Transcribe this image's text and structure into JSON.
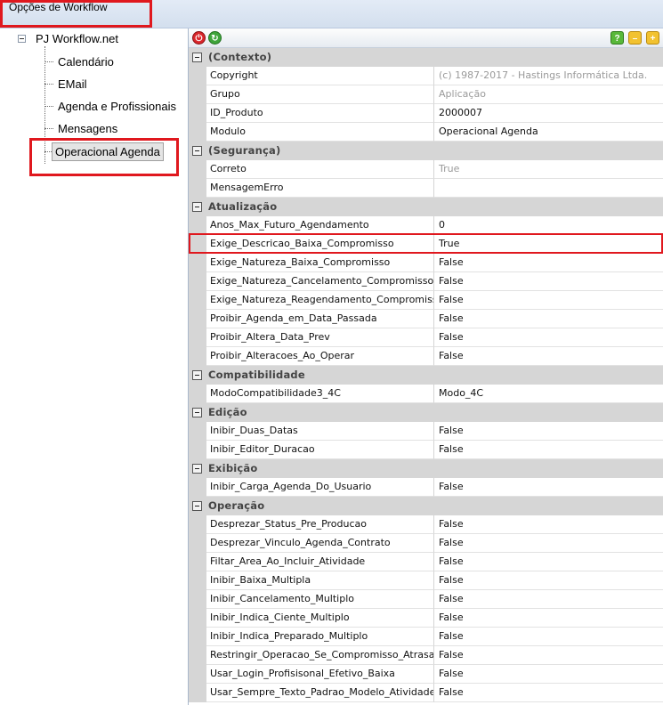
{
  "window": {
    "title": "Opções de Workflow"
  },
  "tree": {
    "root": "PJ Workflow.net",
    "items": [
      "Calendário",
      "EMail",
      "Agenda e Profissionais",
      "Mensagens",
      "Operacional Agenda"
    ]
  },
  "toolbar": {
    "icons": [
      "stop-icon",
      "refresh-icon",
      "help-icon",
      "minimize-icon",
      "add-icon"
    ]
  },
  "grid": {
    "categories": {
      "contexto": "(Contexto)",
      "seguranca": "(Segurança)",
      "atualizacao": "Atualização",
      "compatibilidade": "Compatibilidade",
      "edicao": "Edição",
      "exibicao": "Exibição",
      "operacao": "Operação"
    },
    "rows": {
      "copyright": {
        "name": "Copyright",
        "value": "(c) 1987-2017 - Hastings Informática Ltda."
      },
      "grupo": {
        "name": "Grupo",
        "value": "Aplicação"
      },
      "id_produto": {
        "name": "ID_Produto",
        "value": "2000007"
      },
      "modulo": {
        "name": "Modulo",
        "value": "Operacional Agenda"
      },
      "correto": {
        "name": "Correto",
        "value": "True"
      },
      "mensagem_erro": {
        "name": "MensagemErro",
        "value": ""
      },
      "anos_max": {
        "name": "Anos_Max_Futuro_Agendamento",
        "value": "0"
      },
      "exige_descricao": {
        "name": "Exige_Descricao_Baixa_Compromisso",
        "value": "True"
      },
      "exige_natureza_baixa": {
        "name": "Exige_Natureza_Baixa_Compromisso",
        "value": "False"
      },
      "exige_natureza_cancel": {
        "name": "Exige_Natureza_Cancelamento_Compromisso",
        "value": "False"
      },
      "exige_natureza_reag": {
        "name": "Exige_Natureza_Reagendamento_Compromisso",
        "value": "False"
      },
      "proibir_agenda_passada": {
        "name": "Proibir_Agenda_em_Data_Passada",
        "value": "False"
      },
      "proibir_altera_data": {
        "name": "Proibir_Altera_Data_Prev",
        "value": "False"
      },
      "proibir_alteracoes": {
        "name": "Proibir_Alteracoes_Ao_Operar",
        "value": "False"
      },
      "modo_compat": {
        "name": "ModoCompatibilidade3_4C",
        "value": "Modo_4C"
      },
      "inibir_duas_datas": {
        "name": "Inibir_Duas_Datas",
        "value": "False"
      },
      "inibir_editor": {
        "name": "Inibir_Editor_Duracao",
        "value": "False"
      },
      "inibir_carga": {
        "name": "Inibir_Carga_Agenda_Do_Usuario",
        "value": "False"
      },
      "desprezar_status": {
        "name": "Desprezar_Status_Pre_Producao",
        "value": "False"
      },
      "desprezar_vinculo": {
        "name": "Desprezar_Vinculo_Agenda_Contrato",
        "value": "False"
      },
      "filtar_area": {
        "name": "Filtar_Area_Ao_Incluir_Atividade",
        "value": "False"
      },
      "inibir_baixa": {
        "name": "Inibir_Baixa_Multipla",
        "value": "False"
      },
      "inibir_cancelamento": {
        "name": "Inibir_Cancelamento_Multiplo",
        "value": "False"
      },
      "inibir_ciente": {
        "name": "Inibir_Indica_Ciente_Multiplo",
        "value": "False"
      },
      "inibir_preparado": {
        "name": "Inibir_Indica_Preparado_Multiplo",
        "value": "False"
      },
      "restringir": {
        "name": "Restringir_Operacao_Se_Compromisso_Atrasado",
        "value": "False"
      },
      "usar_login": {
        "name": "Usar_Login_Profisisonal_Efetivo_Baixa",
        "value": "False"
      },
      "usar_sempre": {
        "name": "Usar_Sempre_Texto_Padrao_Modelo_Atividade",
        "value": "False"
      }
    }
  },
  "colors": {
    "highlight": "#e0181e",
    "category_bg": "#d6d6d6",
    "readonly_text": "#9a9a9a"
  }
}
